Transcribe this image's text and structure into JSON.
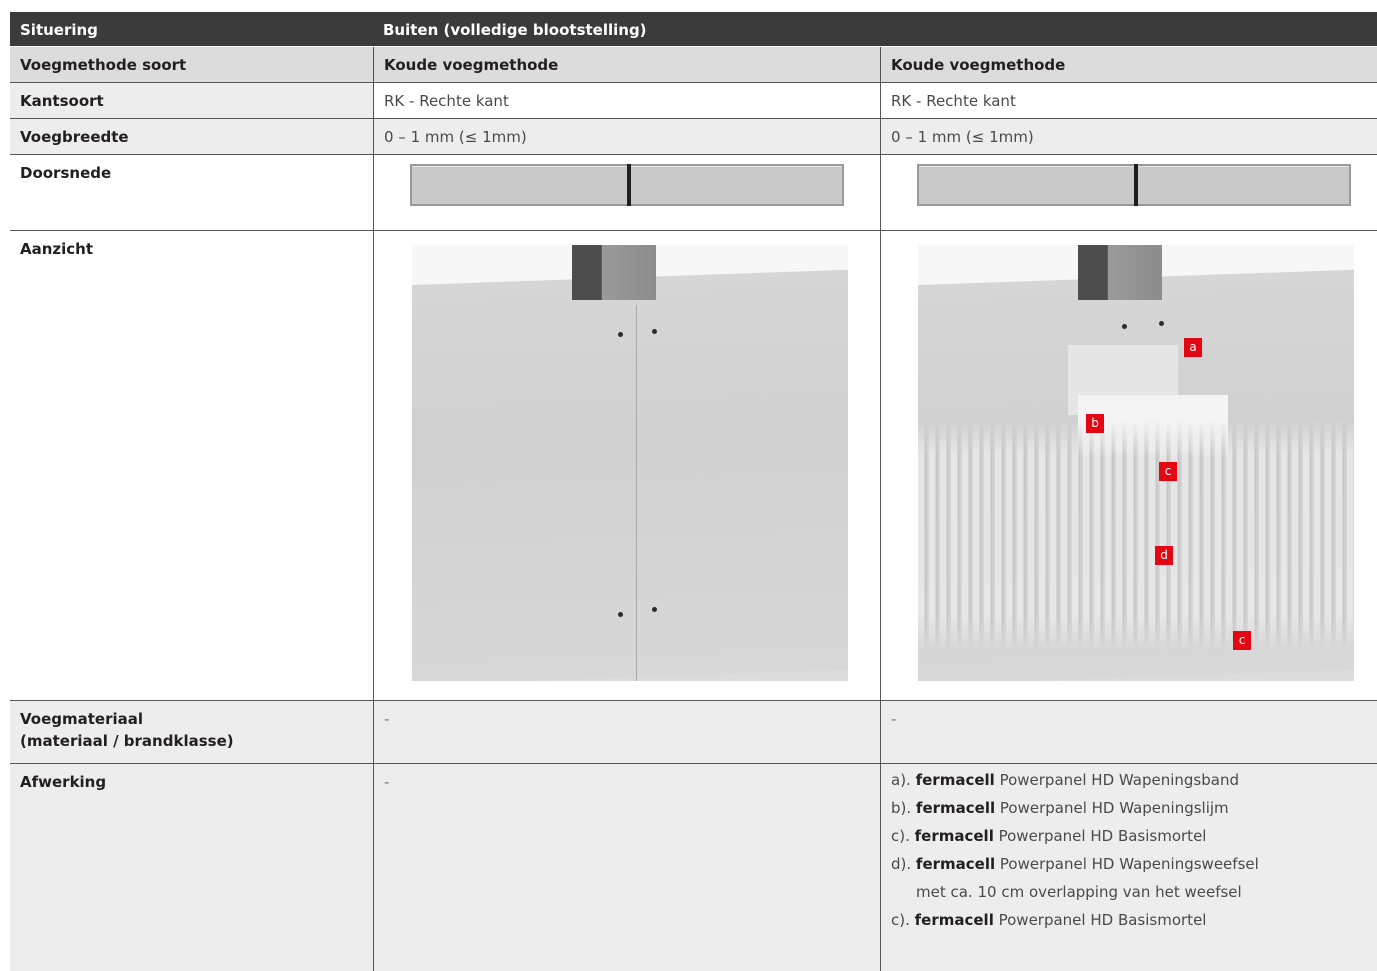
{
  "rows": {
    "situering": {
      "label": "Situering",
      "value": "Buiten (volledige blootstelling)"
    },
    "voegmethode": {
      "label": "Voegmethode soort",
      "col1": "Koude voegmethode",
      "col2": "Koude voegmethode"
    },
    "kantsoort": {
      "label": "Kantsoort",
      "col1": "RK - Rechte kant",
      "col2": "RK - Rechte kant"
    },
    "voegbreedte": {
      "label": "Voegbreedte",
      "col1": "0 – 1 mm (≤ 1mm)",
      "col2": "0 – 1 mm (≤ 1mm)"
    },
    "doorsnede": {
      "label": "Doorsnede"
    },
    "aanzicht": {
      "label": "Aanzicht",
      "tags": [
        "a",
        "b",
        "c",
        "d",
        "c"
      ]
    },
    "voegmateriaal": {
      "label_line1": "Voegmateriaal",
      "label_line2": "(materiaal / brandklasse)",
      "col1": "-",
      "col2": "-"
    },
    "afwerking": {
      "label": "Afwerking",
      "col1": "-",
      "items": [
        {
          "prefix": "a). ",
          "brand": "fermacell",
          "text": " Powerpanel HD Wapeningsband"
        },
        {
          "prefix": "b). ",
          "brand": "fermacell",
          "text": " Powerpanel HD Wapeningslijm"
        },
        {
          "prefix": "c). ",
          "brand": "fermacell",
          "text": " Powerpanel HD Basismortel"
        },
        {
          "prefix": "d). ",
          "brand": "fermacell",
          "text": " Powerpanel HD Wapeningsweefsel"
        },
        {
          "prefix": "",
          "brand": "",
          "text": "met ca. 10 cm overlapping van het weefsel"
        },
        {
          "prefix": "c). ",
          "brand": "fermacell",
          "text": " Powerpanel HD Basismortel"
        }
      ]
    }
  },
  "colors": {
    "header_bg": "#3b3b3b",
    "subheader_bg": "#dcdcdc",
    "light_bg": "#ededed",
    "tag_red": "#e30613"
  }
}
